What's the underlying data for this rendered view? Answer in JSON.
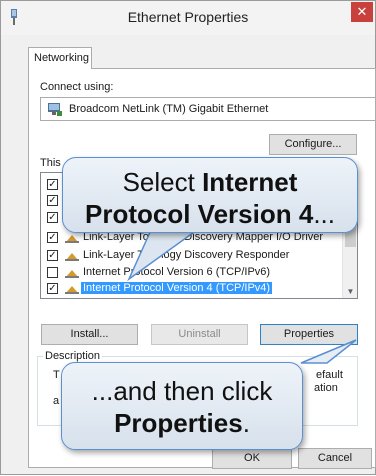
{
  "window": {
    "title": "Ethernet Properties",
    "close_glyph": "✕"
  },
  "tabs": [
    {
      "label": "Networking",
      "active": true
    }
  ],
  "connect_using": {
    "label": "Connect using:",
    "adapter": "Broadcom NetLink (TM) Gigabit Ethernet",
    "adapter_icon": "network-adapter-icon"
  },
  "buttons": {
    "configure": "Configure...",
    "install": "Install...",
    "uninstall": "Uninstall",
    "properties": "Properties",
    "ok": "OK",
    "cancel": "Cancel"
  },
  "components": {
    "label": "This",
    "items": [
      {
        "text": "",
        "checked": true
      },
      {
        "text": "",
        "checked": true
      },
      {
        "text": "",
        "checked": true
      },
      {
        "text": "Link-Layer Topology Discovery Mapper I/O Driver",
        "checked": true
      },
      {
        "text": "Link-Layer Topology Discovery Responder",
        "checked": true
      },
      {
        "text": "Internet Protocol Version 6 (TCP/IPv6)",
        "checked": false
      },
      {
        "text": "Internet Protocol Version 4 (TCP/IPv4)",
        "checked": true,
        "selected": true
      }
    ]
  },
  "description": {
    "label": "Description",
    "text_left": "T",
    "text_left2": "a",
    "text_right": "efault",
    "text_right2": "ation"
  },
  "callouts": {
    "top_line1_plain": "Select ",
    "top_line1_bold": "Internet",
    "top_line2_bold": "Protocol Version 4",
    "top_line2_plain": "...",
    "bottom_line1": "...and then click",
    "bottom_line2_bold": "Properties",
    "bottom_line2_plain": "."
  },
  "colors": {
    "selection": "#3399ff",
    "close_button": "#c8413c",
    "callout_border": "#5a8fd0"
  }
}
